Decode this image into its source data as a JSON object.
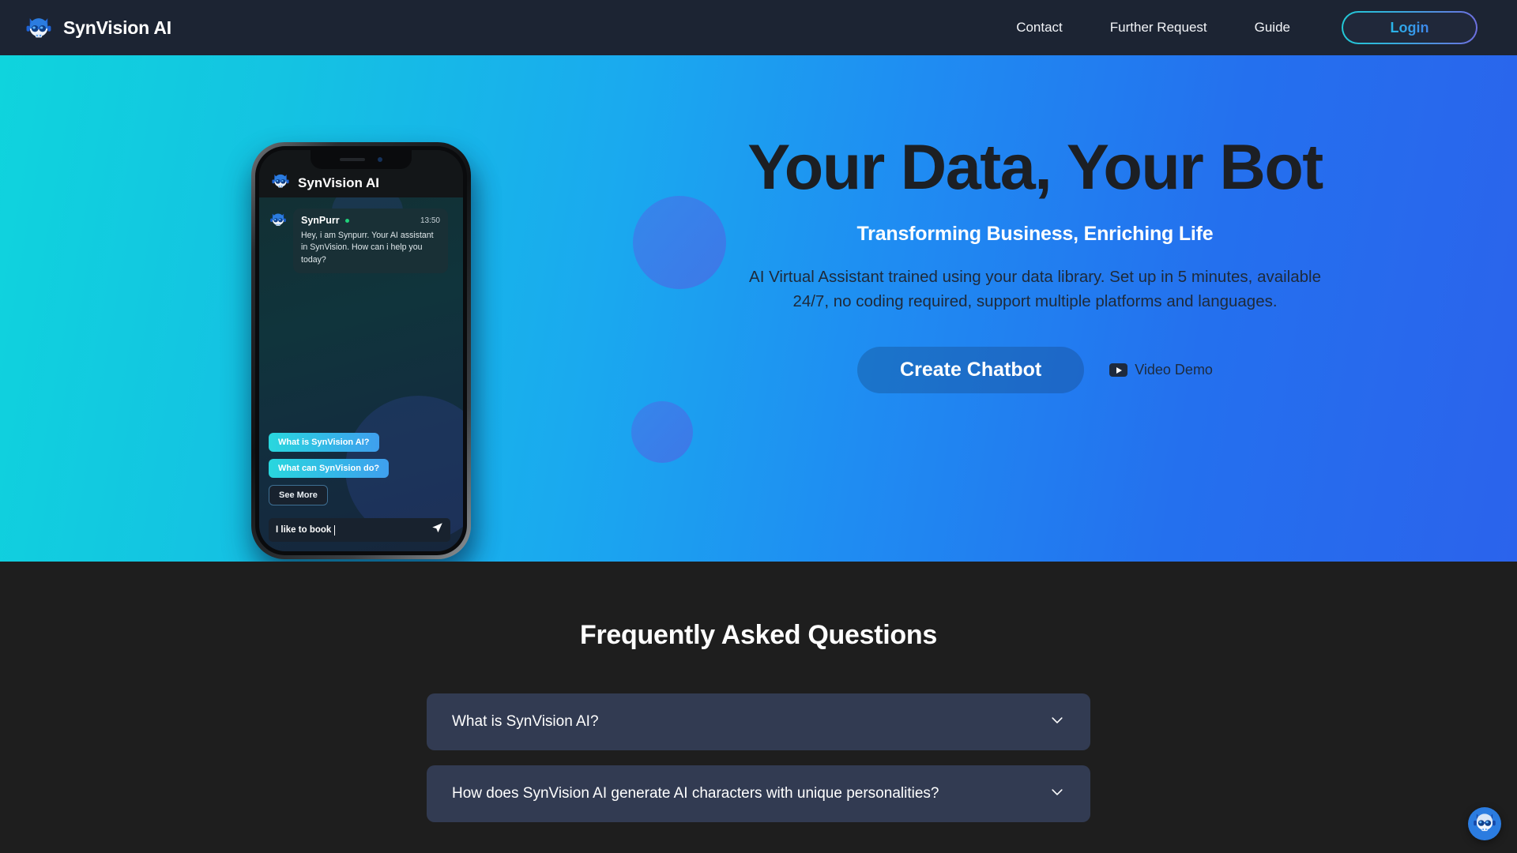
{
  "nav": {
    "brand": "SynVision AI",
    "brand_logo_icon": "cat-robot-mascot-icon",
    "links": [
      {
        "label": "Contact"
      },
      {
        "label": "Further Request"
      },
      {
        "label": "Guide"
      }
    ],
    "login_label": "Login"
  },
  "hero": {
    "title": "Your Data, Your Bot",
    "subtitle": "Transforming Business, Enriching Life",
    "description": "AI Virtual Assistant trained using your data library. Set up in 5 minutes, available 24/7, no coding required, support multiple platforms and languages.",
    "cta_label": "Create Chatbot",
    "video_demo_label": "Video Demo",
    "video_icon": "youtube-play-icon",
    "gradient_start": "#0fd4dd",
    "gradient_end": "#2b63ec",
    "decor_circle_color": "#3f7bea"
  },
  "phone": {
    "header_title": "SynVision AI",
    "header_logo_icon": "cat-robot-mascot-icon",
    "message": {
      "sender": "SynPurr",
      "status_icon": "online-dot-icon",
      "time": "13:50",
      "text": "Hey, i am Synpurr. Your AI assistant in SynVision. How can i help you today?"
    },
    "quick_replies": [
      {
        "label": "What is SynVision AI?",
        "style": "gradient"
      },
      {
        "label": "What can SynVision do?",
        "style": "gradient"
      },
      {
        "label": "See More",
        "style": "outline"
      }
    ],
    "input_value": "I like to book",
    "send_icon": "send-paper-plane-icon"
  },
  "faq": {
    "title": "Frequently Asked Questions",
    "items": [
      {
        "question": "What is SynVision AI?",
        "chevron": "chevron-down-icon"
      },
      {
        "question": "How does SynVision AI generate AI characters with unique personalities?",
        "chevron": "chevron-down-icon"
      }
    ]
  },
  "float_widget": {
    "icon": "cat-robot-mascot-icon",
    "color": "#2b7ce0"
  }
}
